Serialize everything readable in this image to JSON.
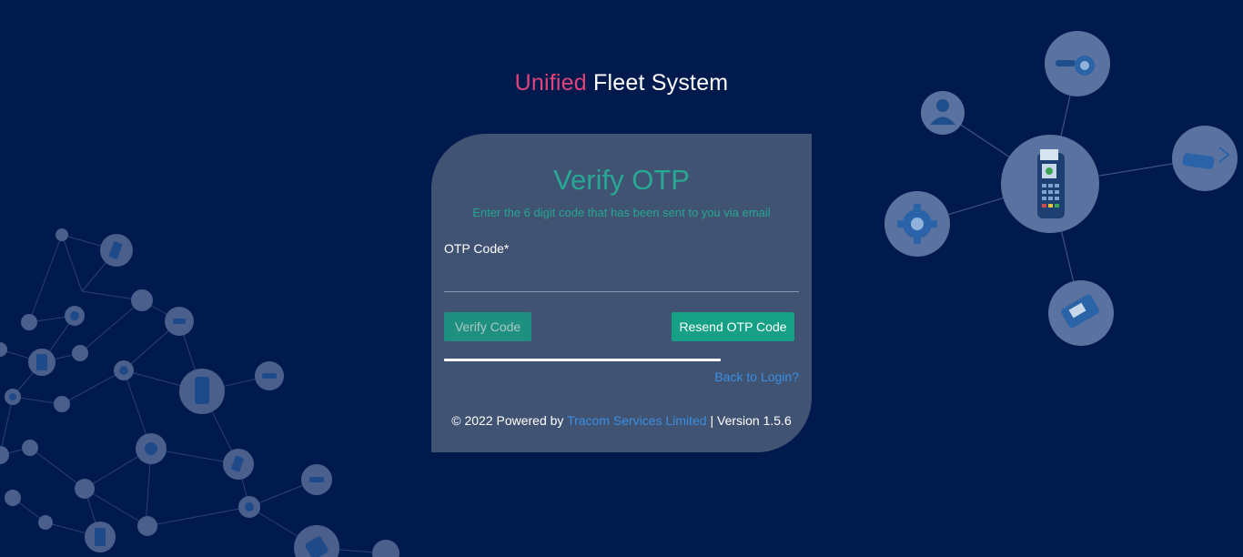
{
  "app_title": {
    "accent": "Unified",
    "main": "Fleet System"
  },
  "card": {
    "title": "Verify OTP",
    "subtitle": "Enter the 6 digit code that has been sent to you via email",
    "otp_label": "OTP Code*",
    "otp_value": "",
    "verify_label": "Verify Code",
    "resend_label": "Resend OTP Code",
    "back_link": "Back to Login?",
    "progress_fraction": 0.78
  },
  "footer": {
    "prefix": "© 2022 Powered by ",
    "company": "Tracom Services Limited",
    "suffix": " | Version 1.5.6"
  },
  "colors": {
    "background": "#001a4e",
    "card": "#415373",
    "accent_pink": "#e0447a",
    "accent_teal": "#16a085",
    "link_blue": "#3a8de0"
  },
  "decorations": {
    "icons": [
      "user-icon",
      "eye-icon",
      "card-swipe-icon",
      "pos-terminal-icon",
      "gear-icon",
      "card-terminal-icon"
    ]
  }
}
